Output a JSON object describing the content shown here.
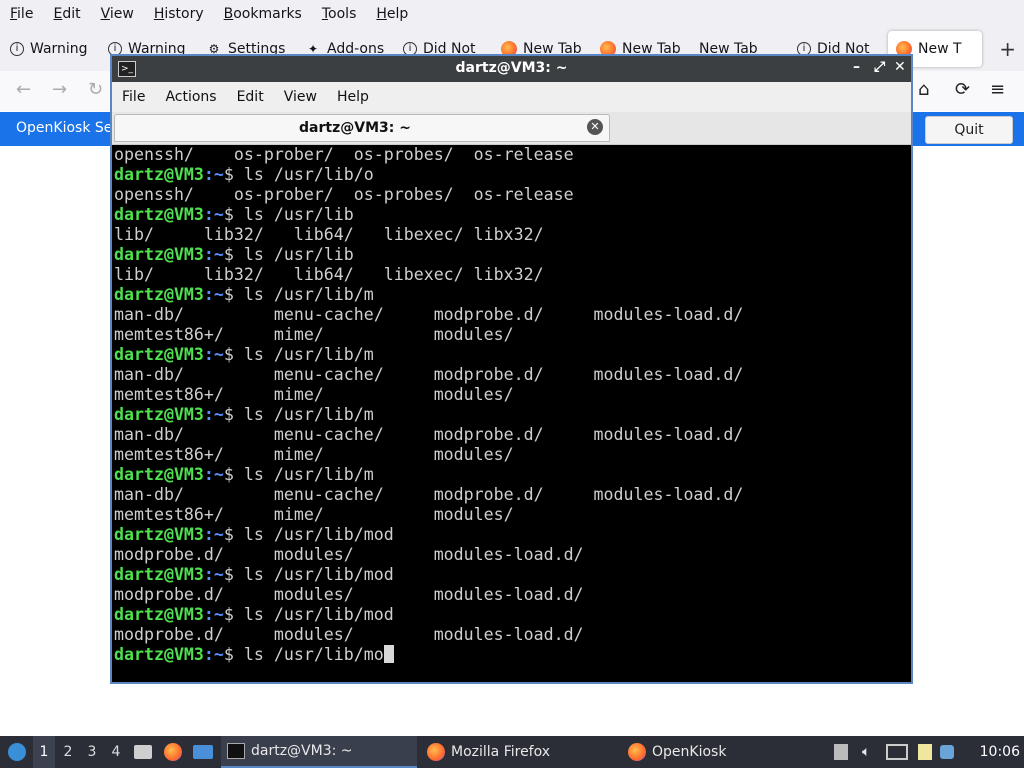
{
  "firefox": {
    "menu": [
      "File",
      "Edit",
      "View",
      "History",
      "Bookmarks",
      "Tools",
      "Help"
    ],
    "tabs": [
      {
        "label": "Warning",
        "icon": "info-icon"
      },
      {
        "label": "Warning",
        "icon": "info-icon"
      },
      {
        "label": "Settings",
        "icon": "gear-icon"
      },
      {
        "label": "Add-ons",
        "icon": "puzzle-icon"
      },
      {
        "label": "Did Not",
        "icon": "info-icon"
      },
      {
        "label": "New Tab",
        "icon": "firefox-icon"
      },
      {
        "label": "New Tab",
        "icon": "firefox-icon"
      },
      {
        "label": "New Tab",
        "icon": ""
      },
      {
        "label": "Did Not",
        "icon": "info-icon"
      },
      {
        "label": "New T",
        "icon": "firefox-icon"
      }
    ],
    "banner_text": "OpenKiosk Set",
    "quit_label": "Quit",
    "new_tab_symbol": "+"
  },
  "terminal": {
    "window_title": "dartz@VM3: ~",
    "menu": [
      "File",
      "Actions",
      "Edit",
      "View",
      "Help"
    ],
    "tab_label": "dartz@VM3: ~",
    "prompt_user": "dartz@VM3",
    "prompt_path": ":~",
    "prompt_symbol": "$ ",
    "lines": [
      {
        "type": "out",
        "text": "openssh/    os-prober/  os-probes/  os-release"
      },
      {
        "type": "cmd",
        "text": "ls /usr/lib/o"
      },
      {
        "type": "out",
        "text": "openssh/    os-prober/  os-probes/  os-release"
      },
      {
        "type": "cmd",
        "text": "ls /usr/lib"
      },
      {
        "type": "out",
        "text": "lib/     lib32/   lib64/   libexec/ libx32/"
      },
      {
        "type": "cmd",
        "text": "ls /usr/lib"
      },
      {
        "type": "out",
        "text": "lib/     lib32/   lib64/   libexec/ libx32/"
      },
      {
        "type": "cmd",
        "text": "ls /usr/lib/m"
      },
      {
        "type": "out",
        "text": "man-db/         menu-cache/     modprobe.d/     modules-load.d/"
      },
      {
        "type": "out",
        "text": "memtest86+/     mime/           modules/"
      },
      {
        "type": "cmd",
        "text": "ls /usr/lib/m"
      },
      {
        "type": "out",
        "text": "man-db/         menu-cache/     modprobe.d/     modules-load.d/"
      },
      {
        "type": "out",
        "text": "memtest86+/     mime/           modules/"
      },
      {
        "type": "cmd",
        "text": "ls /usr/lib/m"
      },
      {
        "type": "out",
        "text": "man-db/         menu-cache/     modprobe.d/     modules-load.d/"
      },
      {
        "type": "out",
        "text": "memtest86+/     mime/           modules/"
      },
      {
        "type": "cmd",
        "text": "ls /usr/lib/m"
      },
      {
        "type": "out",
        "text": "man-db/         menu-cache/     modprobe.d/     modules-load.d/"
      },
      {
        "type": "out",
        "text": "memtest86+/     mime/           modules/"
      },
      {
        "type": "cmd",
        "text": "ls /usr/lib/mod"
      },
      {
        "type": "out",
        "text": "modprobe.d/     modules/        modules-load.d/"
      },
      {
        "type": "cmd",
        "text": "ls /usr/lib/mod"
      },
      {
        "type": "out",
        "text": "modprobe.d/     modules/        modules-load.d/"
      },
      {
        "type": "cmd",
        "text": "ls /usr/lib/mod"
      },
      {
        "type": "out",
        "text": "modprobe.d/     modules/        modules-load.d/"
      },
      {
        "type": "cmd",
        "text": "ls /usr/lib/mo",
        "cursor": true
      }
    ]
  },
  "taskbar": {
    "workspaces": [
      "1",
      "2",
      "3",
      "4"
    ],
    "windows": [
      {
        "label": "dartz@VM3: ~",
        "icon": "terminal-icon"
      },
      {
        "label": "Mozilla Firefox",
        "icon": "firefox-icon"
      },
      {
        "label": "OpenKiosk",
        "icon": "firefox-icon"
      }
    ],
    "clock": "10:06"
  }
}
